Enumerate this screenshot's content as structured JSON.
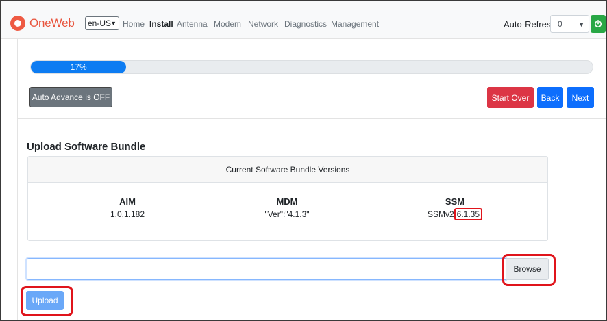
{
  "navbar": {
    "brand": "OneWeb",
    "language": "en-US",
    "links": [
      "Home",
      "Install",
      "Antenna",
      "Modem",
      "Network",
      "Diagnostics",
      "Management"
    ],
    "active_link": "Install",
    "auto_refresh_label": "Auto-Refresh",
    "auto_refresh_value": "0"
  },
  "progress": {
    "label": "17%",
    "value": 17
  },
  "buttons": {
    "auto_advance": "Auto Advance is OFF",
    "start_over": "Start Over",
    "back": "Back",
    "next": "Next",
    "browse": "Browse",
    "upload": "Upload"
  },
  "section_title": "Upload Software Bundle",
  "versions": {
    "header": "Current Software Bundle Versions",
    "items": [
      {
        "name": "AIM",
        "value": "1.0.1.182"
      },
      {
        "name": "MDM",
        "value": "\"Ver\":\"4.1.3\""
      },
      {
        "name": "SSM",
        "prefix": "SSMv2",
        "value": "6.1.35"
      }
    ]
  },
  "file_input": {
    "value": ""
  },
  "colors": {
    "brand": "#e8553e",
    "primary": "#0d6efd",
    "danger": "#dc3545",
    "success": "#28a745",
    "annotation": "#e0141b"
  }
}
